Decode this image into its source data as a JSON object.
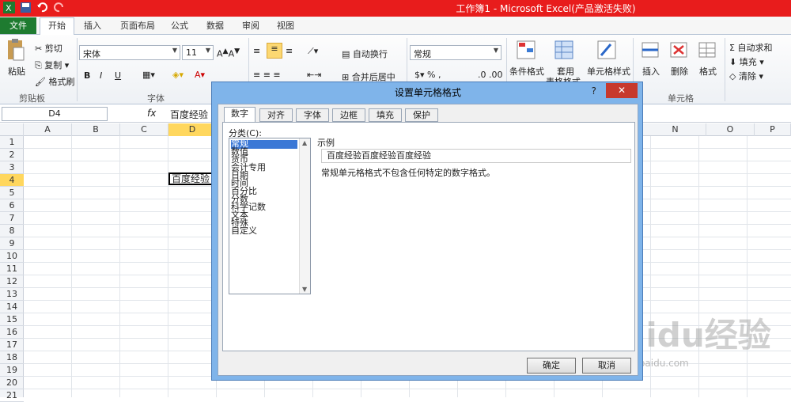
{
  "window": {
    "title": "工作簿1 - Microsoft Excel(产品激活失败)"
  },
  "tabs": {
    "file": "文件",
    "home": "开始",
    "insert": "插入",
    "layout": "页面布局",
    "formula": "公式",
    "data": "数据",
    "review": "审阅",
    "view": "视图"
  },
  "ribbon": {
    "clipboard": {
      "paste": "粘贴",
      "cut": "剪切",
      "copy": "复制",
      "format_painter": "格式刷",
      "label": "剪贴板"
    },
    "font": {
      "name": "宋体",
      "size": "11",
      "bold": "B",
      "italic": "I",
      "underline": "U",
      "label": "字体"
    },
    "alignment": {
      "wrap": "自动换行",
      "merge": "合并后居中"
    },
    "number": {
      "format": "常规"
    },
    "styles": {
      "conditional": "条件格式",
      "table": "套用",
      "table2": "表格格式",
      "cell": "单元格样式"
    },
    "cells": {
      "insert": "插入",
      "delete": "删除",
      "format": "格式",
      "label": "单元格"
    },
    "editing": {
      "autosum": "Σ 自动求和",
      "fill": "填充",
      "clear": "清除"
    }
  },
  "formula_bar": {
    "cell_ref": "D4",
    "fx": "fx",
    "content": "百度经验"
  },
  "columns": [
    "A",
    "B",
    "C",
    "D",
    "N",
    "O",
    "P"
  ],
  "rows": [
    "1",
    "2",
    "3",
    "4",
    "5",
    "6",
    "7",
    "8",
    "9",
    "10",
    "11",
    "12",
    "13",
    "14",
    "15",
    "16",
    "17",
    "18",
    "19",
    "20",
    "21"
  ],
  "cell_d4": "百度经验",
  "dialog": {
    "title": "设置单元格格式",
    "help": "?",
    "close": "✕",
    "tabs": [
      "数字",
      "对齐",
      "字体",
      "边框",
      "填充",
      "保护"
    ],
    "category_label": "分类(C):",
    "categories": [
      "常规",
      "数值",
      "货币",
      "会计专用",
      "日期",
      "时间",
      "百分比",
      "分数",
      "科学记数",
      "文本",
      "特殊",
      "自定义"
    ],
    "sample_label": "示例",
    "sample_value": "百度经验百度经验百度经验",
    "description": "常规单元格格式不包含任何特定的数字格式。",
    "ok": "确定",
    "cancel": "取消"
  },
  "watermark": {
    "text": "Baidu经验",
    "url": "jingyan.baidu.com"
  }
}
